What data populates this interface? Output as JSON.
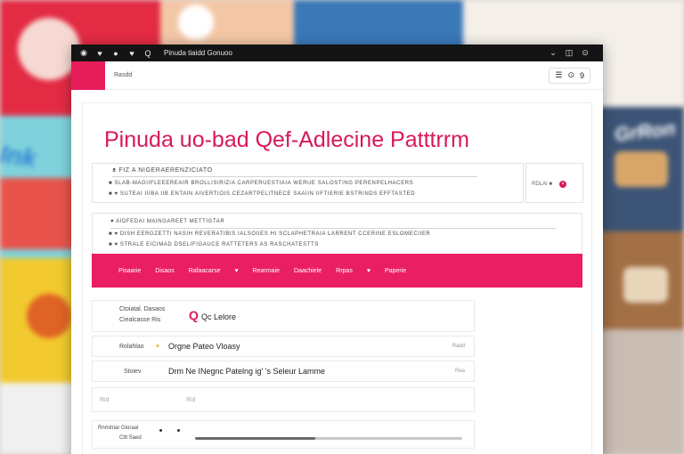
{
  "titlebar": {
    "title": "Pinuda tiaidd Gonuoo",
    "icons": [
      "app-icon",
      "heart-icon",
      "chat-icon",
      "heart-icon",
      "search-icon"
    ],
    "right_icons": [
      "minimize-icon",
      "restore-icon",
      "close-icon"
    ]
  },
  "navbar": {
    "text": "Rasdd",
    "right_icons": [
      "menu-icon",
      "search-icon",
      "user-icon"
    ],
    "right_glyphs": [
      "☰",
      "⊙",
      "9"
    ]
  },
  "main": {
    "headline": "Pinuda uo-bad Qef-Adlecine Patttrrm",
    "card_a": {
      "title": "ᴥ FIZ A NIGERAERENZICIATO",
      "line1": "■ SLAB-MAGIIFLEEEREAIR BROLLISIRIZ/A CARPERUESTIAIA WERUE SALOSTING PERENPELHACERS",
      "line2": "■ ♥ SUTEAI IIIBA IIB ENTAIN AIVERTIOIS CEZARTPELITNECE SAAIIN IIFTIERIE BSTRINDS EFFTASTED",
      "side_text": "RDLAI ■"
    },
    "card_b": {
      "line1": "♥ AIDFEDAI MAINGAREET METTIGTAR",
      "line2": "■ ♥ DISH EERGZETTI NASIH REVERATIBIS IALSOIIES HI SCLAPHETRAIA LARRENT CCERINE ESLOMECIIER",
      "line3": "■ ♥ STRALE EICIMAD DSELIFIGAUCE RATTETERS AS RASCHATESTTS"
    },
    "pinkbar": [
      "Pisaarie",
      "Disaos",
      "Rafaacarse",
      "♥",
      "Rearmaie",
      "Daachiele",
      "Rrpas",
      "♥",
      "Paperie"
    ],
    "rows": {
      "row1_label1": "Ctoiatal. Dasaos",
      "row1_label2": "Ciealcasse Ris",
      "row1_main": "Qc Lelore",
      "row2_label": "Rolahlao",
      "row2_main": "Orgne Pateo Vloasy",
      "row2_right": "Radd",
      "row3_label": "Stoiev",
      "row3_main": "Drm Ne INegnc Patelng ig' 's  Seleur Lamme",
      "row3_right": "Rea",
      "row4_label1": "Rid",
      "row4_label2": "Rid",
      "row5_label": "Rnmitriar Gioraal",
      "row5_sub": "Cltt Saed",
      "slider_value": 0.45
    }
  },
  "colors": {
    "accent": "#e61d5a",
    "pinkbar": "#ea1e62",
    "titlebar": "#141414"
  }
}
